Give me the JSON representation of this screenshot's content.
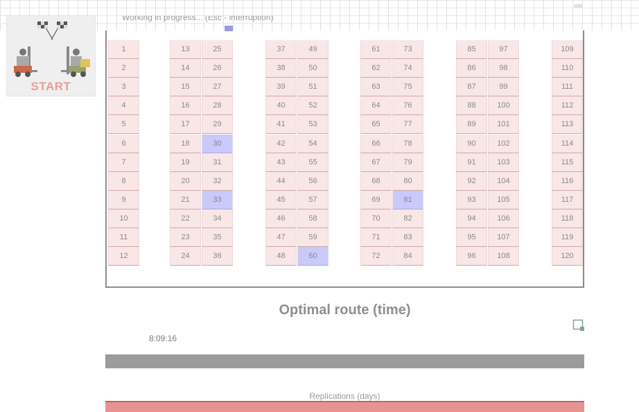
{
  "status": {
    "text": "Working in progress...  (Esc - interruption)",
    "progress": 0.25
  },
  "start_button": {
    "label": "START",
    "icon": "checkered-flags-forklifts-icon"
  },
  "warehouse": {
    "aisles": [
      [
        [
          1,
          2,
          3,
          4,
          5,
          6,
          7,
          8,
          9,
          10,
          11,
          12
        ]
      ],
      [
        [
          13,
          14,
          15,
          16,
          17,
          18,
          19,
          20,
          21,
          22,
          23,
          24
        ],
        [
          25,
          26,
          27,
          28,
          29,
          30,
          31,
          32,
          33,
          34,
          35,
          36
        ]
      ],
      [
        [
          37,
          38,
          39,
          40,
          41,
          42,
          43,
          44,
          45,
          46,
          47,
          48
        ],
        [
          49,
          50,
          51,
          52,
          53,
          54,
          55,
          56,
          57,
          58,
          59,
          60
        ]
      ],
      [
        [
          61,
          62,
          63,
          64,
          65,
          66,
          67,
          68,
          69,
          70,
          71,
          72
        ],
        [
          73,
          74,
          75,
          76,
          77,
          78,
          79,
          80,
          81,
          82,
          83,
          84
        ]
      ],
      [
        [
          85,
          86,
          87,
          88,
          89,
          90,
          91,
          92,
          93,
          94,
          95,
          96
        ],
        [
          97,
          98,
          99,
          100,
          101,
          102,
          103,
          104,
          105,
          106,
          107,
          108
        ]
      ],
      [
        [
          109,
          110,
          111,
          112,
          113,
          114,
          115,
          116,
          117,
          118,
          119,
          120
        ]
      ]
    ],
    "selected_locations": [
      30,
      33,
      60,
      81
    ],
    "colors": {
      "cell": "#f9e6e6",
      "selected_cell": "#c9c9fb",
      "frame": "#8c8c8c"
    }
  },
  "route": {
    "title": "Optimal route (time)",
    "time": "8:09:16",
    "expand_icon": "expand-corner-icon"
  },
  "replications": {
    "label": "Replications (days)"
  },
  "colors": {
    "time_bar": "#9b9b9b",
    "replications_bar": "#e79393",
    "start_text": "#ec9b9b"
  }
}
